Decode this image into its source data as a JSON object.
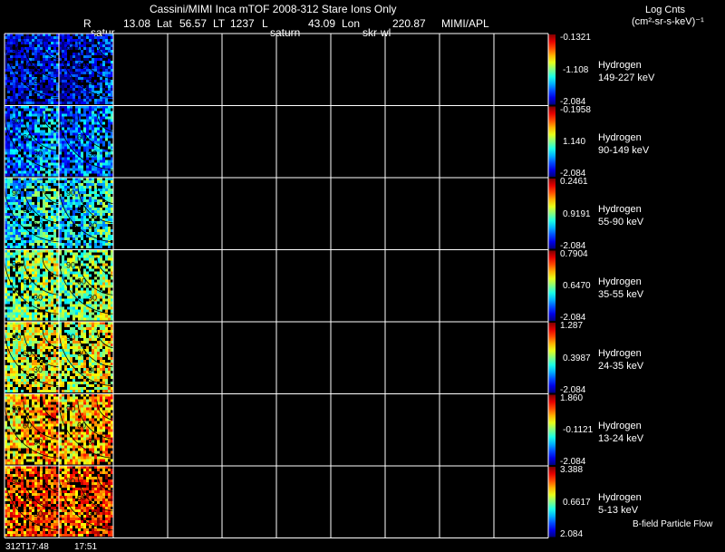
{
  "header": {
    "title": "Cassini/MIMI Inca mTOF  2008-312   Stare    Ions Only",
    "r_label": "R",
    "r_value": "13.08",
    "lat_label": "Lat",
    "lat_value": "56.57",
    "lt_label": "LT",
    "lt_value": "1237",
    "l_label": "L",
    "l_value": "43.09",
    "lon_label": "Lon",
    "lon_value": "220.87",
    "credit": "MIMI/APL",
    "frame_label_1": "satur",
    "frame_label_2": "saturn",
    "frame_label_3": "skr-wl"
  },
  "units": {
    "line1": "Log Cnts",
    "line2": "(cm²-sr-s-keV)⁻¹"
  },
  "footer": {
    "time_1": "312T17:48",
    "time_2": "17:51",
    "flow_label": "B-field Particle Flow"
  },
  "chart_data": {
    "type": "heatmap",
    "description_of_layout": "",
    "time_columns": [
      "312T17:48",
      "17:51"
    ],
    "contour_labels": [
      "90",
      "60",
      "30"
    ],
    "rows": [
      {
        "species": "Hydrogen",
        "energy": "149-227 keV",
        "cbar_top": "-0.1321",
        "cbar_mid": "-1.108",
        "cbar_bottom": "-2.084",
        "level": 0.12
      },
      {
        "species": "Hydrogen",
        "energy": "90-149 keV",
        "cbar_top": "-0.1958",
        "cbar_mid": "1.140",
        "cbar_bottom": "-2.084",
        "level": 0.25
      },
      {
        "species": "Hydrogen",
        "energy": "55-90 keV",
        "cbar_top": "0.2461",
        "cbar_mid": "0.9191",
        "cbar_bottom": "-2.084",
        "level": 0.38
      },
      {
        "species": "Hydrogen",
        "energy": "35-55 keV",
        "cbar_top": "0.7904",
        "cbar_mid": "0.6470",
        "cbar_bottom": "-2.084",
        "level": 0.52
      },
      {
        "species": "Hydrogen",
        "energy": "24-35 keV",
        "cbar_top": "1.287",
        "cbar_mid": "0.3987",
        "cbar_bottom": "-2.084",
        "level": 0.6
      },
      {
        "species": "Hydrogen",
        "energy": "13-24 keV",
        "cbar_top": "1.860",
        "cbar_mid": "-0.1121",
        "cbar_bottom": "-2.084",
        "level": 0.7
      },
      {
        "species": "Hydrogen",
        "energy": "5-13 keV",
        "cbar_top": "3.388",
        "cbar_mid": "0.6617",
        "cbar_bottom": "2.084",
        "level": 0.8
      }
    ]
  }
}
